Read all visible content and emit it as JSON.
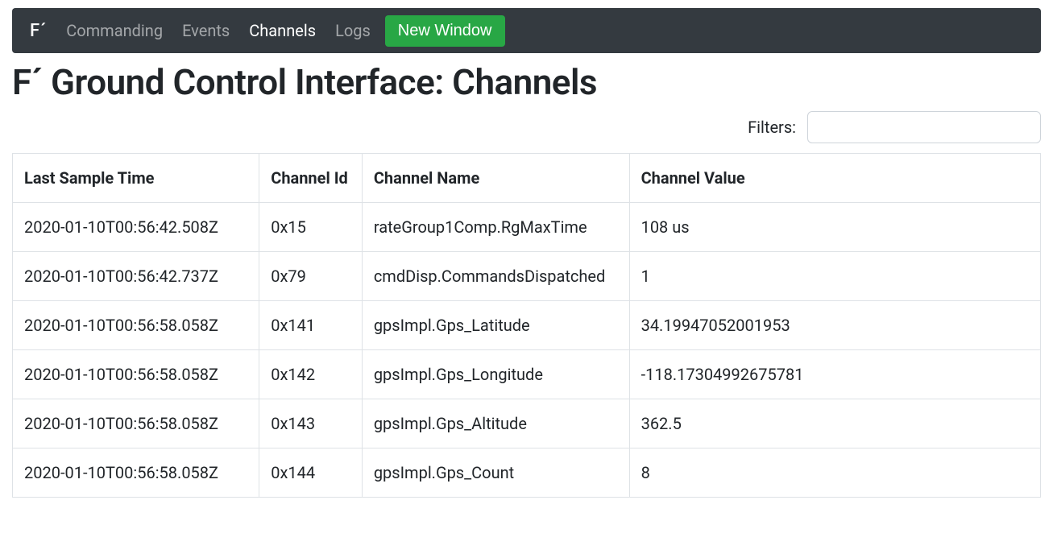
{
  "nav": {
    "brand": "F´",
    "items": [
      {
        "label": "Commanding",
        "active": false
      },
      {
        "label": "Events",
        "active": false
      },
      {
        "label": "Channels",
        "active": true
      },
      {
        "label": "Logs",
        "active": false
      }
    ],
    "new_window": "New Window"
  },
  "page_title": "F´ Ground Control Interface: Channels",
  "filters_label": "Filters:",
  "filters_value": "",
  "table": {
    "headers": {
      "time": "Last Sample Time",
      "id": "Channel Id",
      "name": "Channel Name",
      "value": "Channel Value"
    },
    "rows": [
      {
        "time": "2020-01-10T00:56:42.508Z",
        "id": "0x15",
        "name": "rateGroup1Comp.RgMaxTime",
        "value": "108 us"
      },
      {
        "time": "2020-01-10T00:56:42.737Z",
        "id": "0x79",
        "name": "cmdDisp.CommandsDispatched",
        "value": "1"
      },
      {
        "time": "2020-01-10T00:56:58.058Z",
        "id": "0x141",
        "name": "gpsImpl.Gps_Latitude",
        "value": "34.19947052001953"
      },
      {
        "time": "2020-01-10T00:56:58.058Z",
        "id": "0x142",
        "name": "gpsImpl.Gps_Longitude",
        "value": "-118.17304992675781"
      },
      {
        "time": "2020-01-10T00:56:58.058Z",
        "id": "0x143",
        "name": "gpsImpl.Gps_Altitude",
        "value": "362.5"
      },
      {
        "time": "2020-01-10T00:56:58.058Z",
        "id": "0x144",
        "name": "gpsImpl.Gps_Count",
        "value": "8"
      }
    ]
  }
}
